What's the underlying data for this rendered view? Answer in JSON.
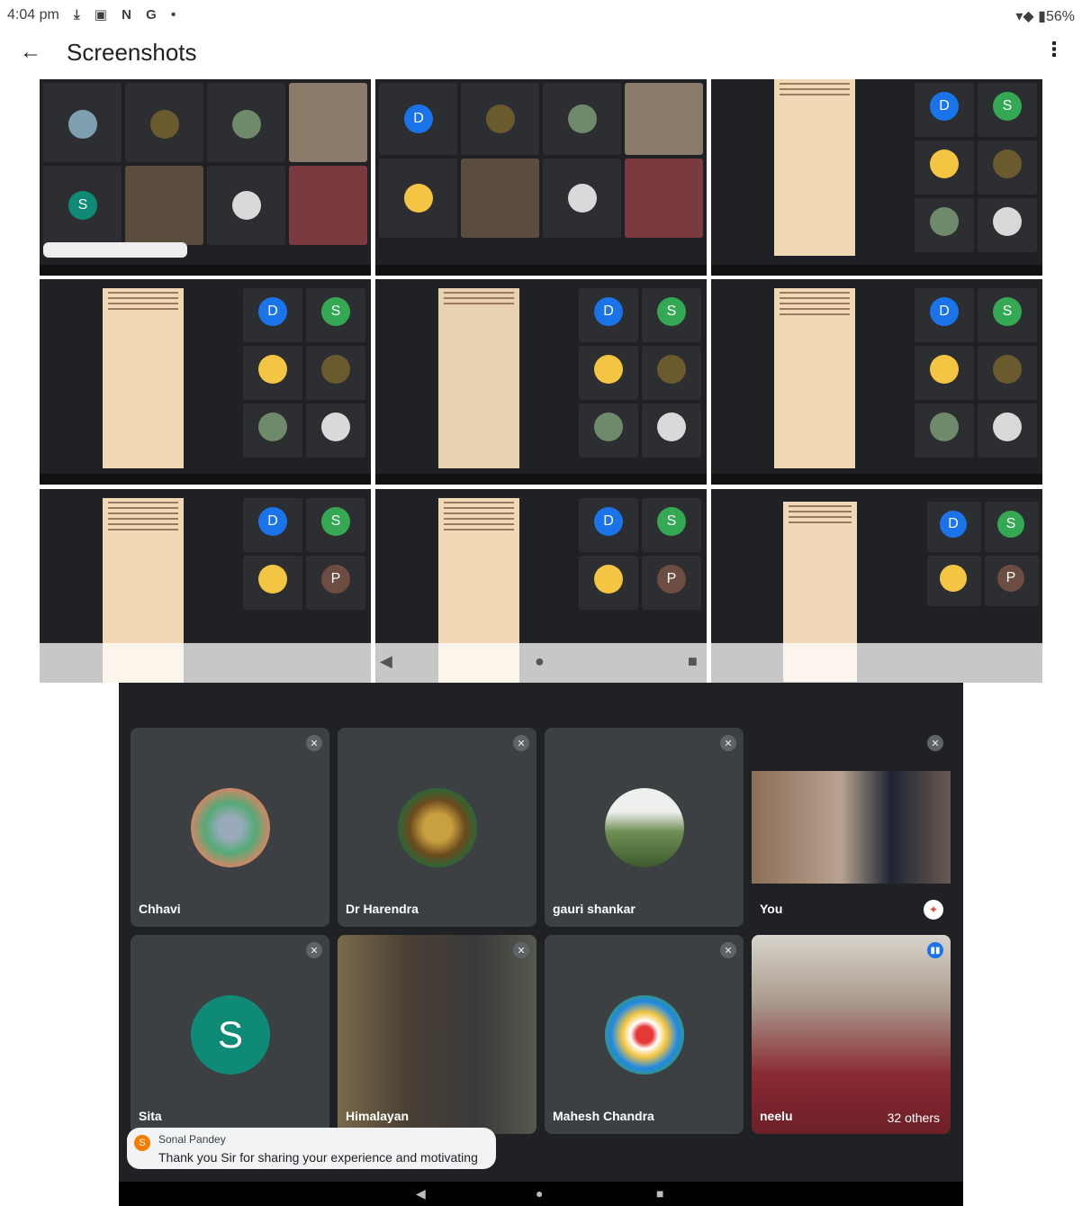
{
  "status_bar": {
    "time": "4:04 pm",
    "notif_icons": "⤓ ▣ N G •",
    "battery": "56%"
  },
  "app_bar": {
    "title": "Screenshots"
  },
  "meeting": {
    "participants": [
      {
        "name": "Chhavi"
      },
      {
        "name": "Dr Harendra"
      },
      {
        "name": "gauri shankar"
      },
      {
        "name": "You"
      },
      {
        "name": "Sita",
        "initial": "S"
      },
      {
        "name": "Himalayan"
      },
      {
        "name": "Mahesh Chandra"
      },
      {
        "name": "neelu",
        "others": "32 others"
      }
    ],
    "chat": {
      "initial": "S",
      "sender": "Sonal Pandey",
      "message": "Thank you Sir for sharing your experience and motivating us."
    }
  },
  "colors": {
    "meet_bg": "#202124",
    "tile_bg": "#3c4043",
    "avatar_green": "#0e8a76",
    "accent_blue": "#1a73e8"
  }
}
